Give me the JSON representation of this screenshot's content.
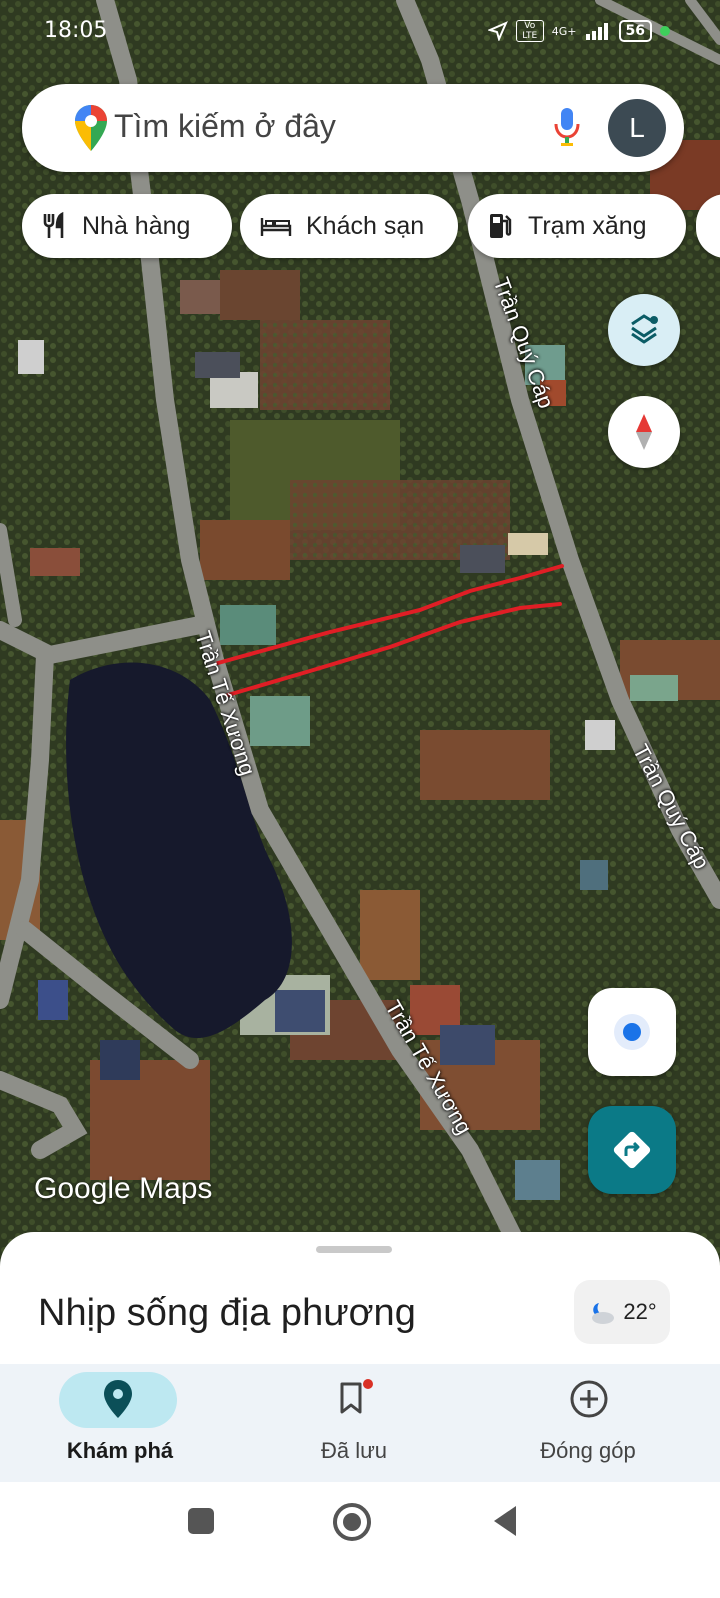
{
  "status": {
    "time": "18:05",
    "network": "4G+",
    "volte": "Vo LTE",
    "battery": "56"
  },
  "search": {
    "placeholder": "Tìm kiếm ở đây",
    "avatar_letter": "L"
  },
  "chips": [
    {
      "label": "Nhà hàng",
      "icon": "fork-knife-icon"
    },
    {
      "label": "Khách sạn",
      "icon": "bed-icon"
    },
    {
      "label": "Trạm xăng",
      "icon": "gas-station-icon"
    }
  ],
  "map": {
    "roads": [
      {
        "name": "Trần Quý Cáp"
      },
      {
        "name": "Trần Quý Cáp"
      },
      {
        "name": "Trần Tế Xương"
      },
      {
        "name": "Trần Tế Xương"
      }
    ],
    "logo": "Google Maps",
    "view": "satellite"
  },
  "sheet": {
    "title": "Nhịp sống địa phương",
    "temperature": "22°"
  },
  "nav": [
    {
      "label": "Khám phá",
      "icon": "explore-pin-icon",
      "active": true
    },
    {
      "label": "Đã lưu",
      "icon": "bookmark-icon",
      "active": false
    },
    {
      "label": "Đóng góp",
      "icon": "add-circle-icon",
      "active": false
    }
  ],
  "colors": {
    "accent": "#0b7a87",
    "active_pill": "#bde8f1",
    "marked_line": "#e01e25"
  }
}
